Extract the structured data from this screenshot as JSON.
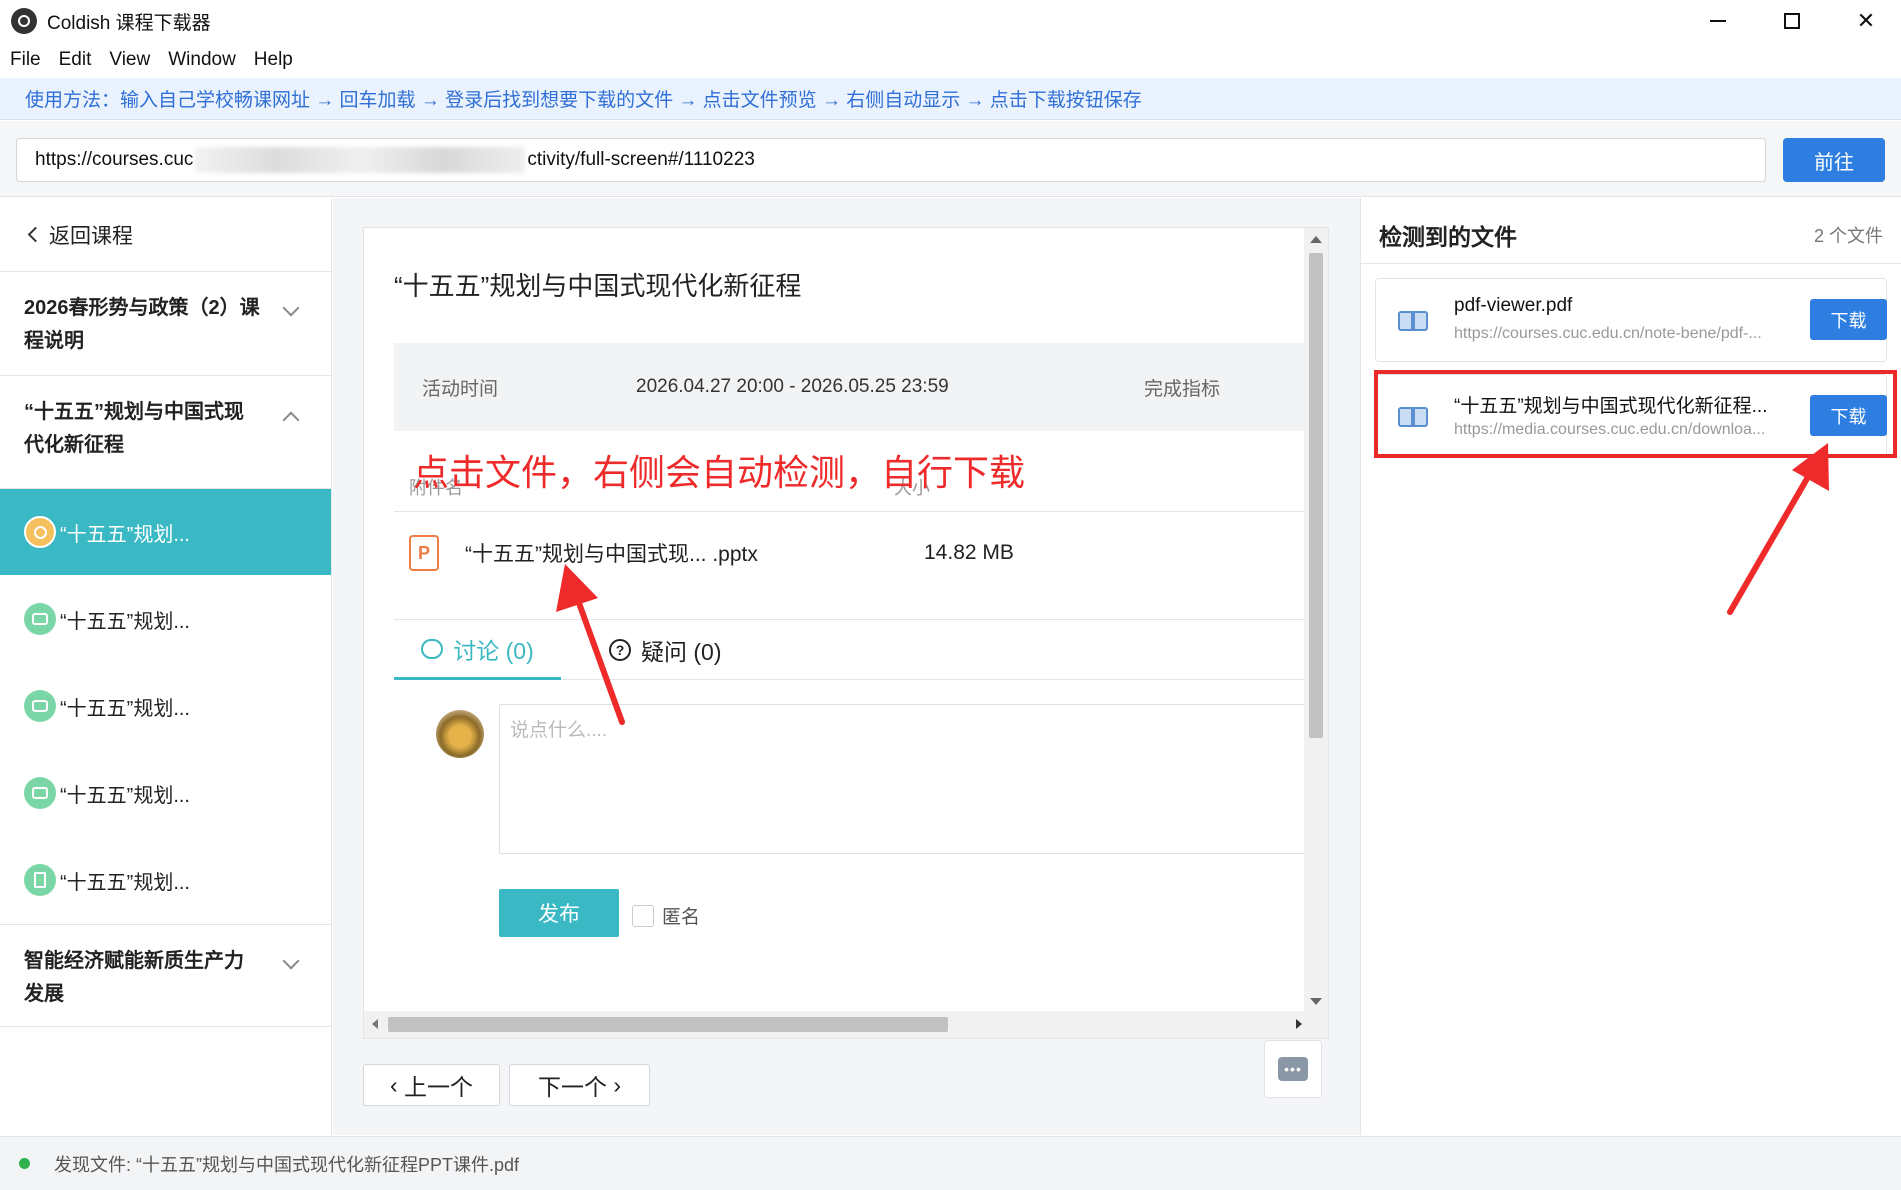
{
  "window": {
    "title": "Coldish 课程下载器"
  },
  "menu": [
    "File",
    "Edit",
    "View",
    "Window",
    "Help"
  ],
  "banner": "使用方法：输入自己学校畅课网址 → 回车加载 → 登录后找到想要下载的文件 → 点击文件预览 → 右侧自动显示 → 点击下载按钮保存",
  "urlbar": {
    "prefix": "https://courses.cuc",
    "suffix": "ctivity/full-screen#/1110223",
    "go_label": "前往"
  },
  "sidebar": {
    "back_label": "返回课程",
    "chapters": [
      {
        "title": "2026春形势与政策（2）课程说明",
        "expanded": false
      },
      {
        "title": "“十五五”规划与中国式现代化新征程",
        "expanded": true
      },
      {
        "title": "智能经济赋能新质生产力发展",
        "expanded": false
      }
    ],
    "lessons": [
      {
        "label": "“十五五”规划...",
        "icon": "attachment-icon",
        "active": true
      },
      {
        "label": "“十五五”规划...",
        "icon": "video-icon",
        "active": false
      },
      {
        "label": "“十五五”规划...",
        "icon": "video-icon",
        "active": false
      },
      {
        "label": "“十五五”规划...",
        "icon": "video-icon",
        "active": false
      },
      {
        "label": "“十五五”规划...",
        "icon": "document-icon",
        "active": false
      }
    ]
  },
  "main": {
    "title": "“十五五”规划与中国式现代化新征程",
    "meta": {
      "time_label": "活动时间",
      "time_value": "2026.04.27 20:00 - 2026.05.25 23:59",
      "completion_label": "完成指标"
    },
    "attachments_header": "附件名",
    "size_header": "大小",
    "attachment": {
      "icon_letter": "P",
      "name": "“十五五”规划与中国式现...",
      "ext": ".pptx",
      "size": "14.82 MB"
    },
    "tabs": [
      {
        "label": "讨论 (0)"
      },
      {
        "label": "疑问 (0)"
      }
    ],
    "comment_placeholder": "说点什么....",
    "publish_label": "发布",
    "anonymous_label": "匿名",
    "prev_label": "上一个",
    "next_label": "下一个",
    "chat_icon_text": "•••"
  },
  "annotation": "点击文件，右侧会自动检测，自行下载",
  "panel": {
    "title": "检测到的文件",
    "count": "2 个文件",
    "files": [
      {
        "name": "pdf-viewer.pdf",
        "url": "https://courses.cuc.edu.cn/note-bene/pdf-...",
        "button": "下载"
      },
      {
        "name": "“十五五”规划与中国式现代化新征程...",
        "url": "https://media.courses.cuc.edu.cn/downloa...",
        "button": "下载"
      }
    ]
  },
  "status": "发现文件: “十五五”规划与中国式现代化新征程PPT课件.pdf",
  "colors": {
    "accent": "#3ab8c3",
    "primary": "#2d7ee0",
    "annotation": "#ee2a2a",
    "banner_text": "#2f6fd6"
  }
}
